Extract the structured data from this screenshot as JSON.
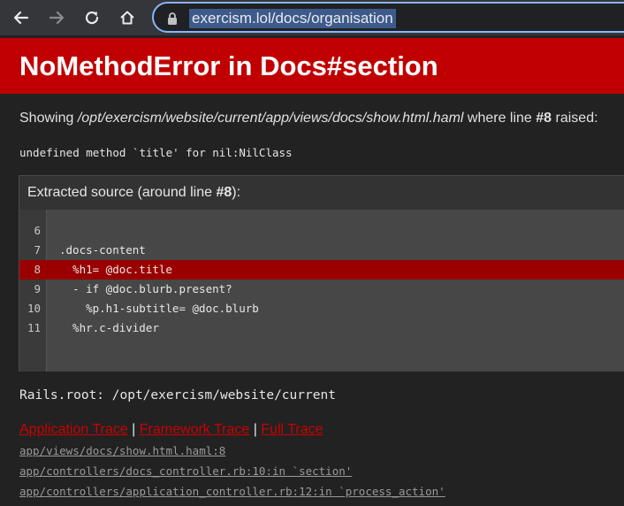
{
  "browser": {
    "url": "exercism.lol/docs/organisation",
    "accent_color": "#8ab4f8"
  },
  "error": {
    "title": "NoMethodError in Docs#section",
    "header_color": "#c00000",
    "showing_prefix": "Showing ",
    "template_path": "/opt/exercism/website/current/app/views/docs/show.html.haml",
    "showing_middle": " where line ",
    "line_ref": "#8",
    "showing_suffix": " raised:",
    "message": "undefined method `title' for nil:NilClass"
  },
  "source": {
    "title_prefix": "Extracted source (around line ",
    "title_line": "#8",
    "title_suffix": "):",
    "lines": [
      {
        "num": "6",
        "code": ""
      },
      {
        "num": "7",
        "code": ".docs-content"
      },
      {
        "num": "8",
        "code": "  %h1= @doc.title"
      },
      {
        "num": "9",
        "code": "  - if @doc.blurb.present?"
      },
      {
        "num": "10",
        "code": "    %p.h1-subtitle= @doc.blurb"
      },
      {
        "num": "11",
        "code": "  %hr.c-divider"
      }
    ],
    "highlight_line": "8"
  },
  "rails_root": "Rails.root: /opt/exercism/website/current",
  "trace": {
    "tabs": [
      {
        "label": "Application Trace"
      },
      {
        "label": "Framework Trace"
      },
      {
        "label": "Full Trace"
      }
    ],
    "separator": " | ",
    "items": [
      {
        "text": "app/views/docs/show.html.haml:8"
      },
      {
        "text": "app/controllers/docs_controller.rb:10:in `section'"
      },
      {
        "text": "app/controllers/application_controller.rb:12:in `process_action'"
      }
    ]
  }
}
